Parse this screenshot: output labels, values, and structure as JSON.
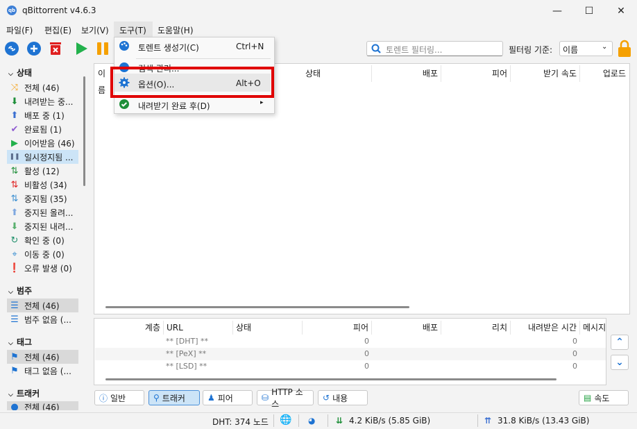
{
  "window": {
    "title": "qBittorrent v4.6.3",
    "app_icon_text": "qb",
    "minimize_glyph": "—",
    "maximize_glyph": "☐",
    "close_glyph": "✕"
  },
  "menubar": [
    "파일(F)",
    "편집(E)",
    "보기(V)",
    "도구(T)",
    "도움말(H)"
  ],
  "toolbar": {
    "search_placeholder": "토렌트 필터링...",
    "filter_label": "필터링 기준:",
    "filter_value": "이름"
  },
  "tools_menu": {
    "items": [
      {
        "label": "토렌트 생성기(C)",
        "shortcut": "Ctrl+N",
        "icon": "palette-icon"
      },
      {
        "label": "검색 관리...",
        "shortcut": "",
        "icon": "rss-icon"
      },
      {
        "label": "옵션(O)...",
        "shortcut": "Alt+O",
        "icon": "gear-icon"
      },
      {
        "label": "내려받기 완료 후(D)",
        "shortcut": "▸",
        "icon": "check-circle-icon"
      }
    ]
  },
  "sidebar": {
    "status_header": "상태",
    "status_items": [
      {
        "label": "전체 (46)",
        "icon": "shuffle-icon",
        "color": "#f5a623"
      },
      {
        "label": "내려받는 중...",
        "icon": "double-chevron-down-icon",
        "color": "#1f8f3a"
      },
      {
        "label": "배포 중 (1)",
        "icon": "double-chevron-up-icon",
        "color": "#3b6fd1"
      },
      {
        "label": "완료됨 (1)",
        "icon": "check-icon",
        "color": "#8e5ad1"
      },
      {
        "label": "이어받음 (46)",
        "icon": "play-icon",
        "color": "#22b14c"
      },
      {
        "label": "일시정지됨 ...",
        "icon": "pause-icon",
        "color": "#5a6b8a"
      },
      {
        "label": "활성 (12)",
        "icon": "updown-arrows-icon",
        "color": "#1f8f3a"
      },
      {
        "label": "비활성 (34)",
        "icon": "updown-arrows-icon",
        "color": "#e02020"
      },
      {
        "label": "중지됨 (35)",
        "icon": "updown-arrows-icon",
        "color": "#3b8fd1"
      },
      {
        "label": "중지된 올려...",
        "icon": "double-chevron-up-icon",
        "color": "#7fa8e0"
      },
      {
        "label": "중지된 내려...",
        "icon": "double-chevron-down-icon",
        "color": "#5ab06f"
      },
      {
        "label": "확인 중 (0)",
        "icon": "refresh-icon",
        "color": "#1f8f6a"
      },
      {
        "label": "이동 중 (0)",
        "icon": "move-icon",
        "color": "#3b8fd1"
      },
      {
        "label": "오류 발생 (0)",
        "icon": "error-icon",
        "color": "#e02020"
      }
    ],
    "category_header": "범주",
    "category_items": [
      {
        "label": "전체 (46)",
        "icon": "list-icon"
      },
      {
        "label": "범주 없음 (...",
        "icon": "list-icon"
      }
    ],
    "tag_header": "태그",
    "tag_items": [
      {
        "label": "전체 (46)",
        "icon": "tag-icon"
      },
      {
        "label": "태그 없음 (...",
        "icon": "tag-icon"
      }
    ],
    "tracker_header": "트래커",
    "tracker_items": [
      {
        "label": "전체 (46)",
        "icon": "globe-icon"
      }
    ]
  },
  "torrent_columns": [
    "이름",
    "상태",
    "배포",
    "피어",
    "받기 속도",
    "업로드"
  ],
  "tracker_columns": [
    "계층",
    "URL",
    "상태",
    "피어",
    "배포",
    "리치",
    "내려받은 시간",
    "메시지"
  ],
  "tracker_rows": [
    {
      "url": "** [DHT] **",
      "peers": "0",
      "downloaded": "0"
    },
    {
      "url": "** [PeX] **",
      "peers": "0",
      "downloaded": "0"
    },
    {
      "url": "** [LSD] **",
      "peers": "0",
      "downloaded": "0"
    }
  ],
  "bottom_tabs": [
    "일반",
    "트래커",
    "피어",
    "HTTP 소스",
    "내용"
  ],
  "speed_button": "속도",
  "status": {
    "dht": "DHT: 374 노드",
    "down": "4.2 KiB/s (5.85 GiB)",
    "up": "31.8 KiB/s (13.43 GiB)"
  },
  "colors": {
    "accent": "#1e73d2",
    "highlight_box": "#e00000"
  }
}
